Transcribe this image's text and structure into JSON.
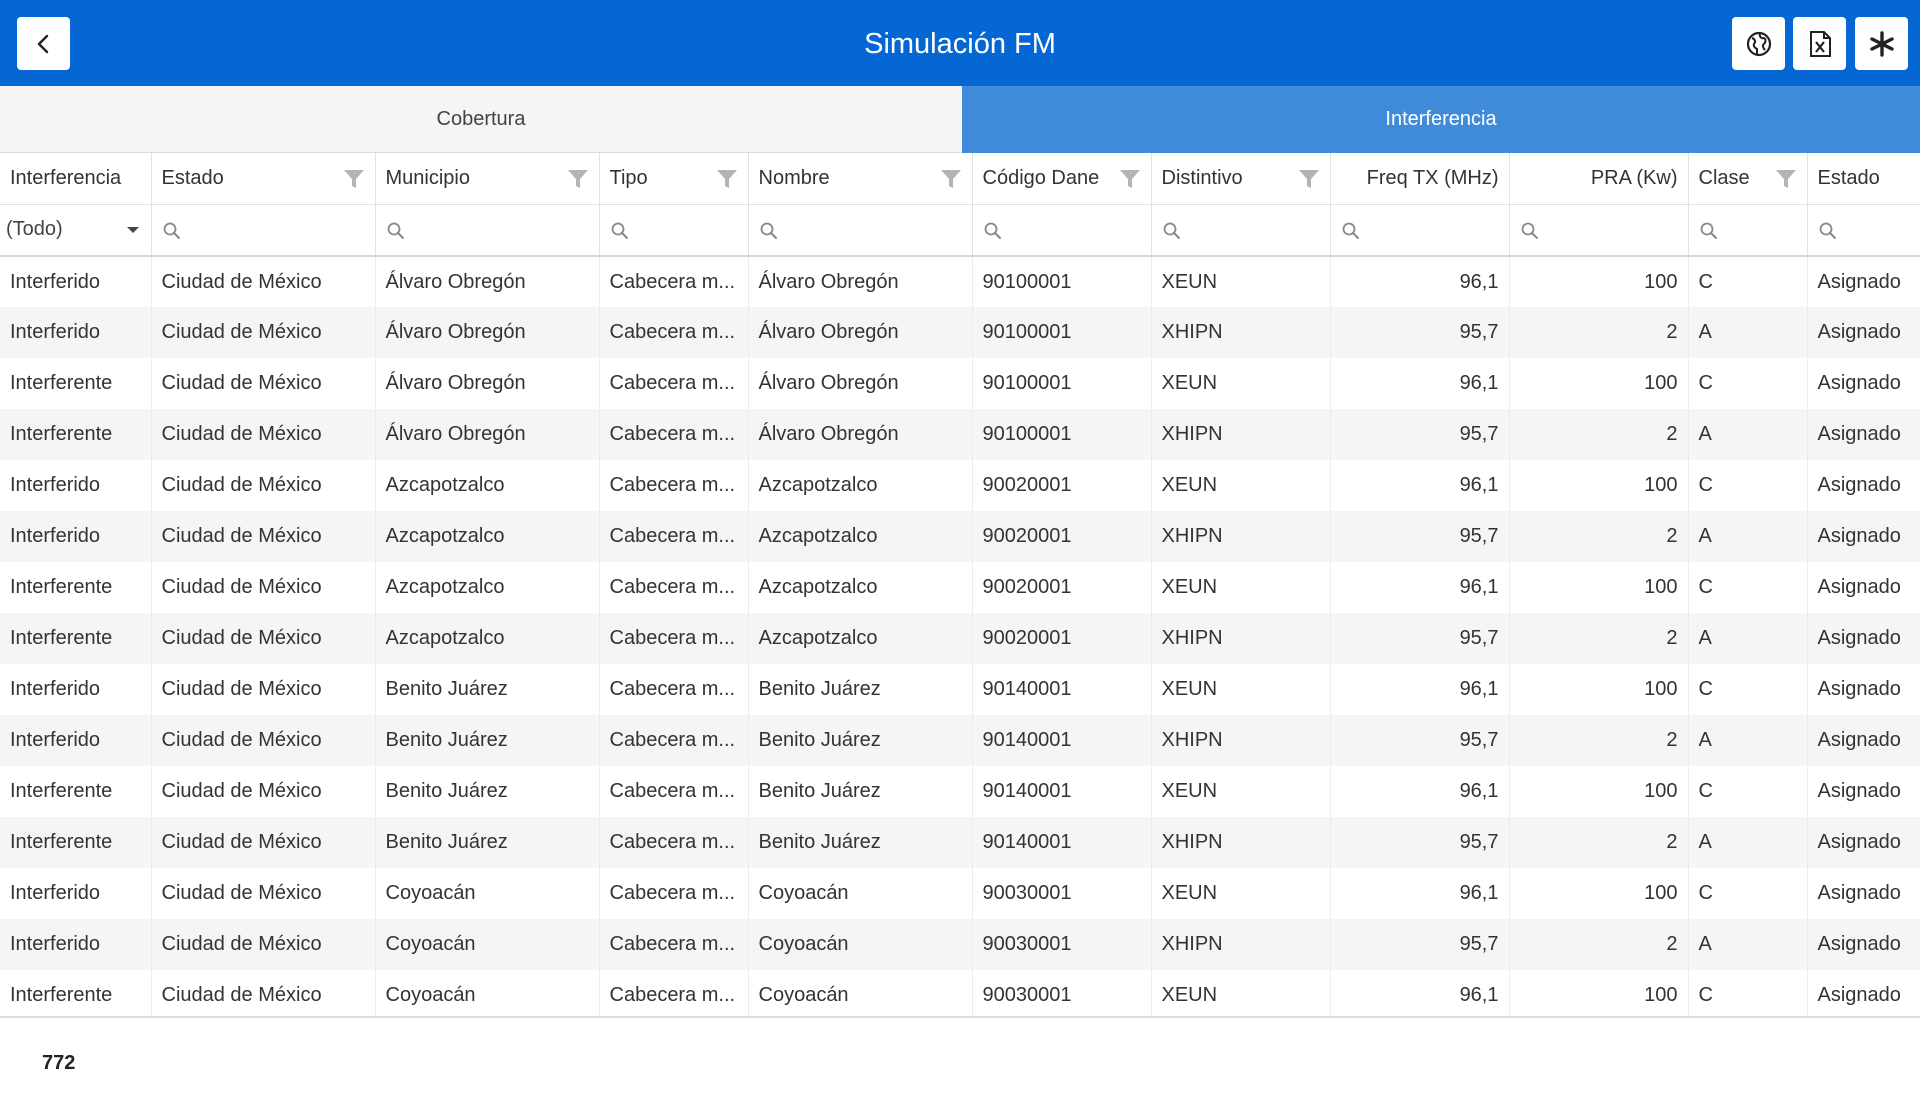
{
  "header": {
    "title": "Simulación FM",
    "back_icon": "chevron-left-icon",
    "buttons": [
      {
        "name": "globe-button",
        "icon": "globe-icon"
      },
      {
        "name": "excel-export-button",
        "icon": "excel-icon"
      },
      {
        "name": "star-button",
        "icon": "asterisk-icon"
      }
    ]
  },
  "tabs": {
    "cobertura": "Cobertura",
    "interferencia": "Interferencia",
    "active": "interferencia"
  },
  "colors": {
    "header_bg": "#0567d3",
    "active_tab_bg": "#3f8ad9",
    "inactive_tab_bg": "#f5f5f5",
    "row_alt_bg": "#f5f5f5"
  },
  "grid": {
    "columns": [
      "Interferencia",
      "Estado",
      "Municipio",
      "Tipo",
      "Nombre",
      "Código Dane",
      "Distintivo",
      "Freq TX (MHz)",
      "PRA (Kw)",
      "Clase",
      "Estado"
    ],
    "filter_select_value": "(Todo)",
    "rows": [
      [
        "Interferido",
        "Ciudad de México",
        "Álvaro Obregón",
        "Cabecera m...",
        "Álvaro Obregón",
        "90100001",
        "XEUN",
        "96,1",
        "100",
        "C",
        "Asignado"
      ],
      [
        "Interferido",
        "Ciudad de México",
        "Álvaro Obregón",
        "Cabecera m...",
        "Álvaro Obregón",
        "90100001",
        "XHIPN",
        "95,7",
        "2",
        "A",
        "Asignado"
      ],
      [
        "Interferente",
        "Ciudad de México",
        "Álvaro Obregón",
        "Cabecera m...",
        "Álvaro Obregón",
        "90100001",
        "XEUN",
        "96,1",
        "100",
        "C",
        "Asignado"
      ],
      [
        "Interferente",
        "Ciudad de México",
        "Álvaro Obregón",
        "Cabecera m...",
        "Álvaro Obregón",
        "90100001",
        "XHIPN",
        "95,7",
        "2",
        "A",
        "Asignado"
      ],
      [
        "Interferido",
        "Ciudad de México",
        "Azcapotzalco",
        "Cabecera m...",
        "Azcapotzalco",
        "90020001",
        "XEUN",
        "96,1",
        "100",
        "C",
        "Asignado"
      ],
      [
        "Interferido",
        "Ciudad de México",
        "Azcapotzalco",
        "Cabecera m...",
        "Azcapotzalco",
        "90020001",
        "XHIPN",
        "95,7",
        "2",
        "A",
        "Asignado"
      ],
      [
        "Interferente",
        "Ciudad de México",
        "Azcapotzalco",
        "Cabecera m...",
        "Azcapotzalco",
        "90020001",
        "XEUN",
        "96,1",
        "100",
        "C",
        "Asignado"
      ],
      [
        "Interferente",
        "Ciudad de México",
        "Azcapotzalco",
        "Cabecera m...",
        "Azcapotzalco",
        "90020001",
        "XHIPN",
        "95,7",
        "2",
        "A",
        "Asignado"
      ],
      [
        "Interferido",
        "Ciudad de México",
        "Benito Juárez",
        "Cabecera m...",
        "Benito Juárez",
        "90140001",
        "XEUN",
        "96,1",
        "100",
        "C",
        "Asignado"
      ],
      [
        "Interferido",
        "Ciudad de México",
        "Benito Juárez",
        "Cabecera m...",
        "Benito Juárez",
        "90140001",
        "XHIPN",
        "95,7",
        "2",
        "A",
        "Asignado"
      ],
      [
        "Interferente",
        "Ciudad de México",
        "Benito Juárez",
        "Cabecera m...",
        "Benito Juárez",
        "90140001",
        "XEUN",
        "96,1",
        "100",
        "C",
        "Asignado"
      ],
      [
        "Interferente",
        "Ciudad de México",
        "Benito Juárez",
        "Cabecera m...",
        "Benito Juárez",
        "90140001",
        "XHIPN",
        "95,7",
        "2",
        "A",
        "Asignado"
      ],
      [
        "Interferido",
        "Ciudad de México",
        "Coyoacán",
        "Cabecera m...",
        "Coyoacán",
        "90030001",
        "XEUN",
        "96,1",
        "100",
        "C",
        "Asignado"
      ],
      [
        "Interferido",
        "Ciudad de México",
        "Coyoacán",
        "Cabecera m...",
        "Coyoacán",
        "90030001",
        "XHIPN",
        "95,7",
        "2",
        "A",
        "Asignado"
      ],
      [
        "Interferente",
        "Ciudad de México",
        "Coyoacán",
        "Cabecera m...",
        "Coyoacán",
        "90030001",
        "XEUN",
        "96,1",
        "100",
        "C",
        "Asignado"
      ]
    ]
  },
  "footer": {
    "record_count": "772"
  }
}
